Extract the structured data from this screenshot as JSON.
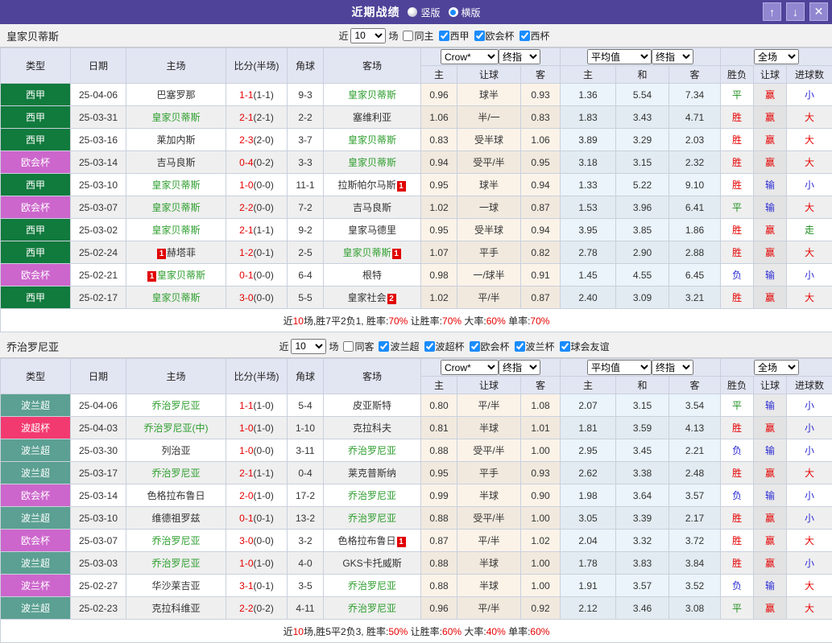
{
  "titlebar": {
    "title": "近期战绩",
    "radio_vertical": "竖版",
    "radio_horizontal": "横版",
    "buttons": {
      "up": "↑",
      "down": "↓",
      "close": "✕"
    }
  },
  "columns": {
    "type": "类型",
    "date": "日期",
    "home": "主场",
    "score": "比分(半场)",
    "corners": "角球",
    "away": "客场",
    "sub": [
      "主",
      "让球",
      "客",
      "主",
      "和",
      "客",
      "胜负",
      "让球",
      "进球数"
    ],
    "group_crow": "Crow*",
    "group_final": "终指",
    "group_avg": "平均值",
    "group_full": "全场"
  },
  "colors": {
    "titlebar": "#4e4399",
    "accent_checkbox": "#1a8cff",
    "win": "#e60000",
    "draw": "#1f8f1f",
    "lose": "#2a2ad4",
    "team_highlight": "#2f9e2f",
    "leagues": {
      "西甲": "#117a3d",
      "欧会杯": "#cc66cc",
      "波兰超": "#5ba092",
      "波超杯": "#f23a70",
      "波兰杯": "#cc66cc"
    }
  },
  "result_colors": {
    "胜": "r",
    "平": "g",
    "负": "b",
    "赢": "r",
    "输": "b",
    "走": "g",
    "大": "r",
    "小": "b"
  },
  "sections": [
    {
      "team": "皇家贝蒂斯",
      "controls": {
        "near_label": "近",
        "matches_value": "10",
        "field_label": "场",
        "same_label": "同主",
        "same_checked": false,
        "leagues": [
          "西甲",
          "欧会杯",
          "西杯"
        ]
      },
      "rows": [
        {
          "league": "西甲",
          "date": "25-04-06",
          "home": {
            "n": "巴塞罗那"
          },
          "score": "1-1",
          "half": "(1-1)",
          "corners": "9-3",
          "away": {
            "n": "皇家贝蒂斯",
            "hl": true
          },
          "crow": [
            "0.96",
            "球半",
            "0.93"
          ],
          "avg": [
            "1.36",
            "5.54",
            "7.34"
          ],
          "res": [
            "平",
            "赢",
            "小"
          ]
        },
        {
          "league": "西甲",
          "date": "25-03-31",
          "home": {
            "n": "皇家贝蒂斯",
            "hl": true
          },
          "score": "2-1",
          "half": "(2-1)",
          "corners": "2-2",
          "away": {
            "n": "塞维利亚"
          },
          "crow": [
            "1.06",
            "半/一",
            "0.83"
          ],
          "avg": [
            "1.83",
            "3.43",
            "4.71"
          ],
          "res": [
            "胜",
            "赢",
            "大"
          ]
        },
        {
          "league": "西甲",
          "date": "25-03-16",
          "home": {
            "n": "莱加内斯"
          },
          "score": "2-3",
          "half": "(2-0)",
          "corners": "3-7",
          "away": {
            "n": "皇家贝蒂斯",
            "hl": true
          },
          "crow": [
            "0.83",
            "受半球",
            "1.06"
          ],
          "avg": [
            "3.89",
            "3.29",
            "2.03"
          ],
          "res": [
            "胜",
            "赢",
            "大"
          ]
        },
        {
          "league": "欧会杯",
          "date": "25-03-14",
          "home": {
            "n": "吉马良斯"
          },
          "score": "0-4",
          "half": "(0-2)",
          "corners": "3-3",
          "away": {
            "n": "皇家贝蒂斯",
            "hl": true
          },
          "crow": [
            "0.94",
            "受平/半",
            "0.95"
          ],
          "avg": [
            "3.18",
            "3.15",
            "2.32"
          ],
          "res": [
            "胜",
            "赢",
            "大"
          ]
        },
        {
          "league": "西甲",
          "date": "25-03-10",
          "home": {
            "n": "皇家贝蒂斯",
            "hl": true
          },
          "score": "1-0",
          "half": "(0-0)",
          "corners": "11-1",
          "away": {
            "n": "拉斯帕尔马斯",
            "post": "1"
          },
          "crow": [
            "0.95",
            "球半",
            "0.94"
          ],
          "avg": [
            "1.33",
            "5.22",
            "9.10"
          ],
          "res": [
            "胜",
            "输",
            "小"
          ]
        },
        {
          "league": "欧会杯",
          "date": "25-03-07",
          "home": {
            "n": "皇家贝蒂斯",
            "hl": true
          },
          "score": "2-2",
          "half": "(0-0)",
          "corners": "7-2",
          "away": {
            "n": "吉马良斯"
          },
          "crow": [
            "1.02",
            "一球",
            "0.87"
          ],
          "avg": [
            "1.53",
            "3.96",
            "6.41"
          ],
          "res": [
            "平",
            "输",
            "大"
          ]
        },
        {
          "league": "西甲",
          "date": "25-03-02",
          "home": {
            "n": "皇家贝蒂斯",
            "hl": true
          },
          "score": "2-1",
          "half": "(1-1)",
          "corners": "9-2",
          "away": {
            "n": "皇家马德里"
          },
          "crow": [
            "0.95",
            "受半球",
            "0.94"
          ],
          "avg": [
            "3.95",
            "3.85",
            "1.86"
          ],
          "res": [
            "胜",
            "赢",
            "走"
          ]
        },
        {
          "league": "西甲",
          "date": "25-02-24",
          "home": {
            "n": "赫塔菲",
            "pre": "1"
          },
          "score": "1-2",
          "half": "(0-1)",
          "corners": "2-5",
          "away": {
            "n": "皇家贝蒂斯",
            "hl": true,
            "post": "1"
          },
          "crow": [
            "1.07",
            "平手",
            "0.82"
          ],
          "avg": [
            "2.78",
            "2.90",
            "2.88"
          ],
          "res": [
            "胜",
            "赢",
            "大"
          ]
        },
        {
          "league": "欧会杯",
          "date": "25-02-21",
          "home": {
            "n": "皇家贝蒂斯",
            "hl": true,
            "pre": "1"
          },
          "score": "0-1",
          "half": "(0-0)",
          "corners": "6-4",
          "away": {
            "n": "根特"
          },
          "crow": [
            "0.98",
            "一/球半",
            "0.91"
          ],
          "avg": [
            "1.45",
            "4.55",
            "6.45"
          ],
          "res": [
            "负",
            "输",
            "小"
          ]
        },
        {
          "league": "西甲",
          "date": "25-02-17",
          "home": {
            "n": "皇家贝蒂斯",
            "hl": true
          },
          "score": "3-0",
          "half": "(0-0)",
          "corners": "5-5",
          "away": {
            "n": "皇家社会",
            "post": "2"
          },
          "crow": [
            "1.02",
            "平/半",
            "0.87"
          ],
          "avg": [
            "2.40",
            "3.09",
            "3.21"
          ],
          "res": [
            "胜",
            "赢",
            "大"
          ]
        }
      ],
      "summary": [
        {
          "text": "近",
          "red": false
        },
        {
          "text": "10",
          "red": true
        },
        {
          "text": "场,胜7平2负1, 胜率:",
          "red": false
        },
        {
          "text": "70%",
          "red": true
        },
        {
          "text": " 让胜率:",
          "red": false
        },
        {
          "text": "70%",
          "red": true
        },
        {
          "text": " 大率:",
          "red": false
        },
        {
          "text": "60%",
          "red": true
        },
        {
          "text": " 单率:",
          "red": false
        },
        {
          "text": "70%",
          "red": true
        }
      ]
    },
    {
      "team": "乔治罗尼亚",
      "controls": {
        "near_label": "近",
        "matches_value": "10",
        "field_label": "场",
        "same_label": "同客",
        "same_checked": false,
        "leagues": [
          "波兰超",
          "波超杯",
          "欧会杯",
          "波兰杯",
          "球会友谊"
        ]
      },
      "rows": [
        {
          "league": "波兰超",
          "date": "25-04-06",
          "home": {
            "n": "乔治罗尼亚",
            "hl": true
          },
          "score": "1-1",
          "half": "(1-0)",
          "corners": "5-4",
          "away": {
            "n": "皮亚斯特"
          },
          "crow": [
            "0.80",
            "平/半",
            "1.08"
          ],
          "avg": [
            "2.07",
            "3.15",
            "3.54"
          ],
          "res": [
            "平",
            "输",
            "小"
          ]
        },
        {
          "league": "波超杯",
          "date": "25-04-03",
          "home": {
            "n": "乔治罗尼亚(中)",
            "hl": true
          },
          "score": "1-0",
          "half": "(1-0)",
          "corners": "1-10",
          "away": {
            "n": "克拉科夫"
          },
          "crow": [
            "0.81",
            "半球",
            "1.01"
          ],
          "avg": [
            "1.81",
            "3.59",
            "4.13"
          ],
          "res": [
            "胜",
            "赢",
            "小"
          ]
        },
        {
          "league": "波兰超",
          "date": "25-03-30",
          "home": {
            "n": "列治亚"
          },
          "score": "1-0",
          "half": "(0-0)",
          "corners": "3-11",
          "away": {
            "n": "乔治罗尼亚",
            "hl": true
          },
          "crow": [
            "0.88",
            "受平/半",
            "1.00"
          ],
          "avg": [
            "2.95",
            "3.45",
            "2.21"
          ],
          "res": [
            "负",
            "输",
            "小"
          ]
        },
        {
          "league": "波兰超",
          "date": "25-03-17",
          "home": {
            "n": "乔治罗尼亚",
            "hl": true
          },
          "score": "2-1",
          "half": "(1-1)",
          "corners": "0-4",
          "away": {
            "n": "莱克普斯纳"
          },
          "crow": [
            "0.95",
            "平手",
            "0.93"
          ],
          "avg": [
            "2.62",
            "3.38",
            "2.48"
          ],
          "res": [
            "胜",
            "赢",
            "大"
          ]
        },
        {
          "league": "欧会杯",
          "date": "25-03-14",
          "home": {
            "n": "色格拉布鲁日"
          },
          "score": "2-0",
          "half": "(1-0)",
          "corners": "17-2",
          "away": {
            "n": "乔治罗尼亚",
            "hl": true
          },
          "crow": [
            "0.99",
            "半球",
            "0.90"
          ],
          "avg": [
            "1.98",
            "3.64",
            "3.57"
          ],
          "res": [
            "负",
            "输",
            "小"
          ]
        },
        {
          "league": "波兰超",
          "date": "25-03-10",
          "home": {
            "n": "维德祖罗兹"
          },
          "score": "0-1",
          "half": "(0-1)",
          "corners": "13-2",
          "away": {
            "n": "乔治罗尼亚",
            "hl": true
          },
          "crow": [
            "0.88",
            "受平/半",
            "1.00"
          ],
          "avg": [
            "3.05",
            "3.39",
            "2.17"
          ],
          "res": [
            "胜",
            "赢",
            "小"
          ]
        },
        {
          "league": "欧会杯",
          "date": "25-03-07",
          "home": {
            "n": "乔治罗尼亚",
            "hl": true
          },
          "score": "3-0",
          "half": "(0-0)",
          "corners": "3-2",
          "away": {
            "n": "色格拉布鲁日",
            "post": "1"
          },
          "crow": [
            "0.87",
            "平/半",
            "1.02"
          ],
          "avg": [
            "2.04",
            "3.32",
            "3.72"
          ],
          "res": [
            "胜",
            "赢",
            "大"
          ]
        },
        {
          "league": "波兰超",
          "date": "25-03-03",
          "home": {
            "n": "乔治罗尼亚",
            "hl": true
          },
          "score": "1-0",
          "half": "(1-0)",
          "corners": "4-0",
          "away": {
            "n": "GKS卡托威斯"
          },
          "crow": [
            "0.88",
            "半球",
            "1.00"
          ],
          "avg": [
            "1.78",
            "3.83",
            "3.84"
          ],
          "res": [
            "胜",
            "赢",
            "小"
          ]
        },
        {
          "league": "波兰杯",
          "date": "25-02-27",
          "home": {
            "n": "华沙莱吉亚"
          },
          "score": "3-1",
          "half": "(0-1)",
          "corners": "3-5",
          "away": {
            "n": "乔治罗尼亚",
            "hl": true
          },
          "crow": [
            "0.88",
            "半球",
            "1.00"
          ],
          "avg": [
            "1.91",
            "3.57",
            "3.52"
          ],
          "res": [
            "负",
            "输",
            "大"
          ]
        },
        {
          "league": "波兰超",
          "date": "25-02-23",
          "home": {
            "n": "克拉科维亚"
          },
          "score": "2-2",
          "half": "(0-2)",
          "corners": "4-11",
          "away": {
            "n": "乔治罗尼亚",
            "hl": true
          },
          "crow": [
            "0.96",
            "平/半",
            "0.92"
          ],
          "avg": [
            "2.12",
            "3.46",
            "3.08"
          ],
          "res": [
            "平",
            "赢",
            "大"
          ]
        }
      ],
      "summary": [
        {
          "text": "近",
          "red": false
        },
        {
          "text": "10",
          "red": true
        },
        {
          "text": "场,胜5平2负3, 胜率:",
          "red": false
        },
        {
          "text": "50%",
          "red": true
        },
        {
          "text": " 让胜率:",
          "red": false
        },
        {
          "text": "60%",
          "red": true
        },
        {
          "text": " 大率:",
          "red": false
        },
        {
          "text": "40%",
          "red": true
        },
        {
          "text": " 单率:",
          "red": false
        },
        {
          "text": "60%",
          "red": true
        }
      ]
    }
  ]
}
